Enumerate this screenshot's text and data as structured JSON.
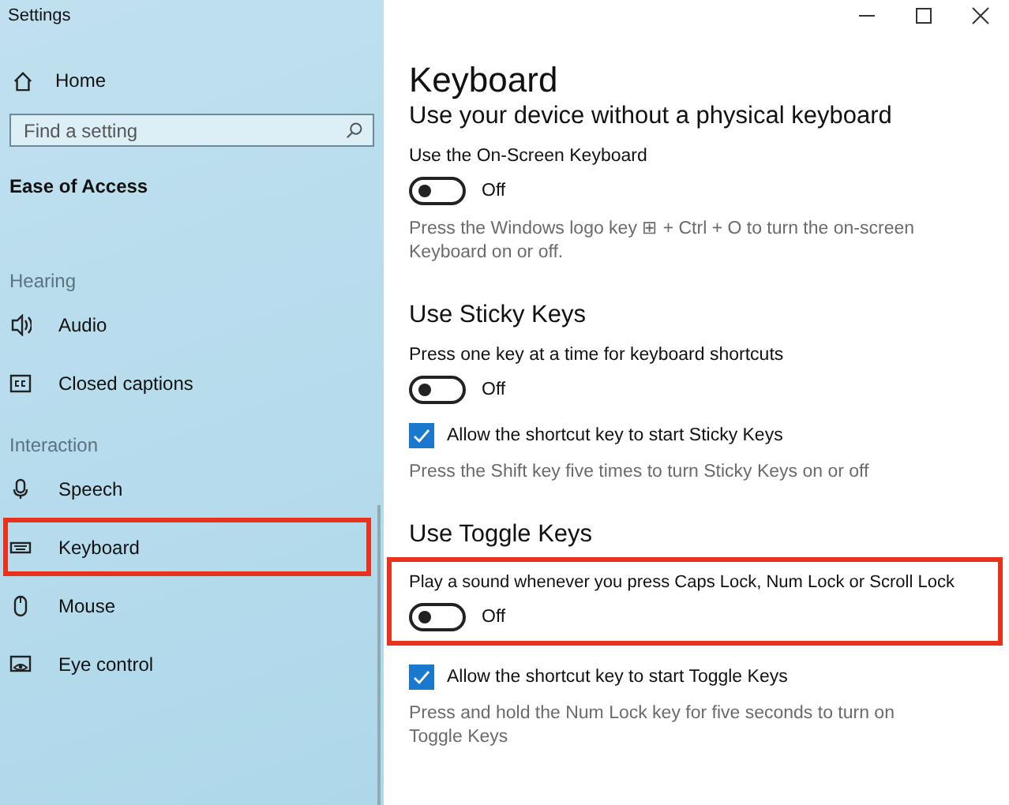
{
  "window": {
    "title": "Settings"
  },
  "sidebar": {
    "home": {
      "label": "Home"
    },
    "search": {
      "placeholder": "Find a setting"
    },
    "category": "Ease of Access",
    "groups": [
      {
        "heading": "Hearing",
        "items": [
          {
            "label": "Audio",
            "kind": "audio",
            "highlighted": false
          },
          {
            "label": "Closed captions",
            "kind": "captions",
            "highlighted": false
          }
        ]
      },
      {
        "heading": "Interaction",
        "items": [
          {
            "label": "Speech",
            "kind": "speech",
            "highlighted": false
          },
          {
            "label": "Keyboard",
            "kind": "keyboard",
            "highlighted": true
          },
          {
            "label": "Mouse",
            "kind": "mouse",
            "highlighted": false
          },
          {
            "label": "Eye control",
            "kind": "eye",
            "highlighted": false
          }
        ]
      }
    ]
  },
  "main": {
    "title": "Keyboard",
    "sections": [
      {
        "heading": "Use your device without a physical keyboard",
        "items": [
          {
            "kind": "toggle",
            "label": "Use the On-Screen Keyboard",
            "on": false,
            "state_text": "Off",
            "highlighted": false
          },
          {
            "kind": "note",
            "text": "Press the Windows logo key ⊞ + Ctrl + O to turn the on-screen Keyboard on or off."
          }
        ]
      },
      {
        "heading": "Use Sticky Keys",
        "items": [
          {
            "kind": "toggle",
            "label": "Press one key at a time for keyboard shortcuts",
            "on": false,
            "state_text": "Off",
            "highlighted": false
          },
          {
            "kind": "checkbox",
            "label": "Allow the shortcut key to start Sticky Keys",
            "checked": true
          },
          {
            "kind": "note",
            "text": "Press the Shift key five times to turn Sticky Keys on or off"
          }
        ]
      },
      {
        "heading": "Use Toggle Keys",
        "items": [
          {
            "kind": "toggle",
            "label": "Play a sound whenever you press Caps Lock, Num Lock or Scroll Lock",
            "on": false,
            "state_text": "Off",
            "highlighted": true
          },
          {
            "kind": "checkbox",
            "label": "Allow the shortcut key to start Toggle Keys",
            "checked": true
          },
          {
            "kind": "note",
            "text": "Press and hold the Num Lock key for five seconds to turn on Toggle Keys"
          }
        ]
      }
    ]
  }
}
